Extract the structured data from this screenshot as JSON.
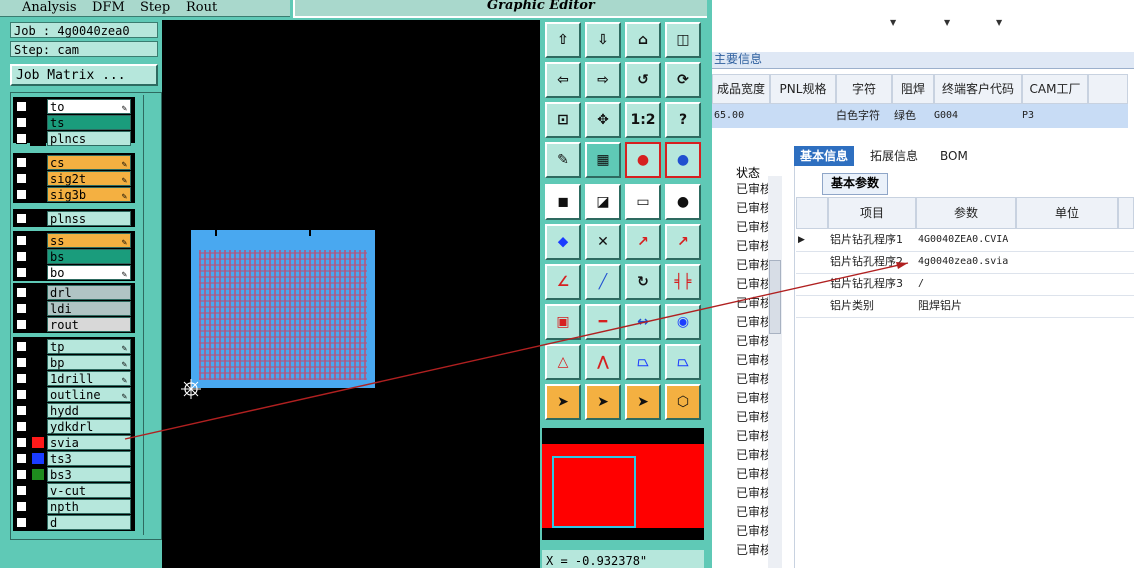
{
  "genesis": {
    "menu": [
      "Analysis",
      "DFM",
      "Step",
      "Rout"
    ],
    "editor_title": "Graphic Editor",
    "job_line": "Job : 4g0040zea0",
    "step_line": "Step: cam",
    "job_matrix": "Job Matrix ...",
    "layers": [
      {
        "name": "to",
        "bg": "#ffffff",
        "pen": true
      },
      {
        "name": "ts",
        "bg": "#1a9c7c",
        "pen": false
      },
      {
        "name": "plncs",
        "bg": "#b6e7dc",
        "pen": false
      },
      {
        "name": "cs",
        "bg": "#f4b041",
        "pen": true
      },
      {
        "name": "sig2t",
        "bg": "#f4b041",
        "pen": true
      },
      {
        "name": "sig3b",
        "bg": "#f4b041",
        "pen": true
      },
      {
        "name": "plnss",
        "bg": "#b6e7dc",
        "pen": false
      },
      {
        "name": "ss",
        "bg": "#f4b041",
        "pen": true
      },
      {
        "name": "bs",
        "bg": "#1a9c7c",
        "pen": false
      },
      {
        "name": "bo",
        "bg": "#ffffff",
        "pen": true
      },
      {
        "name": "drl",
        "bg": "#b0c4c4",
        "pen": false
      },
      {
        "name": "ldi",
        "bg": "#b0c4c4",
        "pen": false
      },
      {
        "name": "rout",
        "bg": "#d8d8d8",
        "pen": false
      },
      {
        "name": "tp",
        "bg": "#b6e7dc",
        "pen": true
      },
      {
        "name": "bp",
        "bg": "#b6e7dc",
        "pen": true
      },
      {
        "name": "1drill",
        "bg": "#b6e7dc",
        "pen": true
      },
      {
        "name": "outline",
        "bg": "#b6e7dc",
        "pen": true
      },
      {
        "name": "hydd",
        "bg": "#b6e7dc",
        "pen": false
      },
      {
        "name": "ydkdrl",
        "bg": "#b6e7dc",
        "pen": false
      },
      {
        "name": "svia",
        "bg": "#b6e7dc",
        "pen": false,
        "swatch": "#ff1a1a"
      },
      {
        "name": "ts3",
        "bg": "#b6e7dc",
        "pen": false,
        "swatch": "#1a3cff"
      },
      {
        "name": "bs3",
        "bg": "#b6e7dc",
        "pen": false,
        "swatch": "#1e8c1e"
      },
      {
        "name": "v-cut",
        "bg": "#b6e7dc",
        "pen": false
      },
      {
        "name": "npth",
        "bg": "#b6e7dc",
        "pen": false
      },
      {
        "name": "d",
        "bg": "#b6e7dc",
        "pen": false
      }
    ],
    "tool_labels": {
      "scale": "1:2",
      "help": "?"
    },
    "coord_readout": "X = -0.932378\""
  },
  "erp": {
    "strip_label": "主要信息",
    "grid_headers": [
      "成品宽度",
      "PNL规格",
      "字符",
      "阻焊",
      "终端客户代码",
      "CAM工厂"
    ],
    "grid_row": [
      "65.00",
      "",
      "白色字符",
      "绿色",
      "G004",
      "P3"
    ],
    "left_header": "状态",
    "left_item": "已审核",
    "tabs": [
      "基本信息",
      "拓展信息",
      "BOM"
    ],
    "subtab": "基本参数",
    "param_headers": [
      "项目",
      "参数",
      "单位"
    ],
    "params": [
      {
        "item": "铝片钻孔程序1",
        "value": "4G0040ZEA0.CVIA",
        "unit": ""
      },
      {
        "item": "铝片钻孔程序2",
        "value": "4g0040zea0.svia",
        "unit": ""
      },
      {
        "item": "铝片钻孔程序3",
        "value": "/",
        "unit": ""
      },
      {
        "item": "铝片类别",
        "value": "阻焊铝片",
        "unit": ""
      }
    ]
  },
  "colors": {
    "genesis_bg": "#5fc9b6",
    "erp_accent": "#2e6fc0",
    "arrow": "#b02020"
  }
}
